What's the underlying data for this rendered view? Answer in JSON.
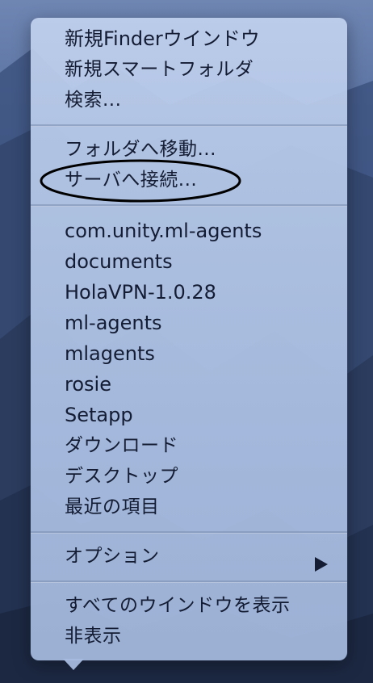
{
  "menu": {
    "group1": [
      "新規Finderウインドウ",
      "新規スマートフォルダ",
      "検索..."
    ],
    "group2": [
      "フォルダへ移動...",
      "サーバへ接続..."
    ],
    "group3": [
      "com.unity.ml-agents",
      "documents",
      "HolaVPN-1.0.28",
      "ml-agents",
      "mlagents",
      "rosie",
      "Setapp",
      "ダウンロード",
      "デスクトップ",
      "最近の項目"
    ],
    "options_label": "オプション",
    "group5": [
      "すべてのウインドウを表示",
      "非表示"
    ]
  },
  "colors": {
    "menu_text": "#141c33",
    "annotation_stroke": "#000000"
  },
  "icons": {
    "submenu": "submenu-arrow-icon"
  }
}
